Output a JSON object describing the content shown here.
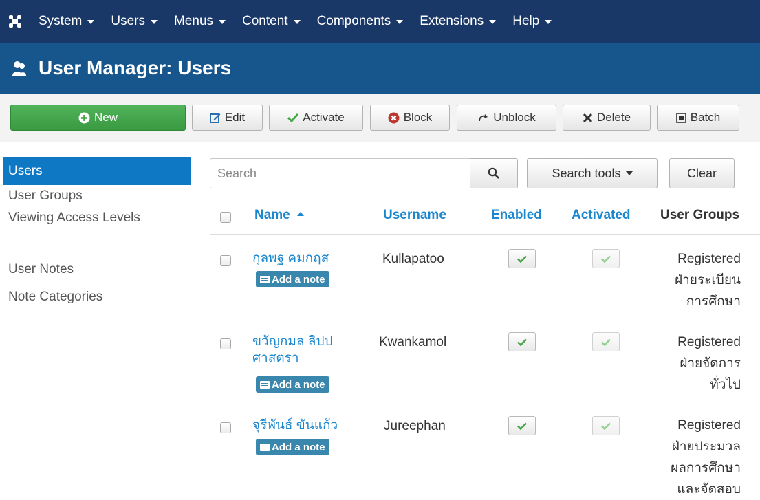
{
  "nav": {
    "menu": [
      {
        "label": "System"
      },
      {
        "label": "Users"
      },
      {
        "label": "Menus"
      },
      {
        "label": "Content"
      },
      {
        "label": "Components"
      },
      {
        "label": "Extensions"
      },
      {
        "label": "Help"
      }
    ]
  },
  "header": {
    "title": "User Manager: Users",
    "icon": "users-icon"
  },
  "toolbar": {
    "new_label": "New",
    "edit_label": "Edit",
    "activate_label": "Activate",
    "block_label": "Block",
    "unblock_label": "Unblock",
    "delete_label": "Delete",
    "batch_label": "Batch"
  },
  "sidebar": {
    "items": [
      {
        "label": "Users"
      },
      {
        "label": "User Groups"
      },
      {
        "label": "Viewing Access Levels"
      },
      {
        "label": "User Notes"
      },
      {
        "label": "Note Categories"
      }
    ]
  },
  "filters": {
    "search_placeholder": "Search",
    "search_tools_label": "Search tools",
    "clear_label": "Clear"
  },
  "table": {
    "columns": {
      "name": "Name",
      "username": "Username",
      "enabled": "Enabled",
      "activated": "Activated",
      "groups": "User Groups"
    },
    "note_label": "Add a note",
    "rows": [
      {
        "name": [
          "กุลพฐ คมกฤส"
        ],
        "username": "Kullapatoo",
        "groups": [
          "Registered",
          "ฝ่ายระเบียน",
          "การศึกษา"
        ]
      },
      {
        "name": [
          "ขวัญกมล ลิปป",
          "ศาสตรา"
        ],
        "username": "Kwankamol",
        "groups": [
          "Registered",
          "ฝ่ายจัดการ",
          "ทั่วไป"
        ]
      },
      {
        "name": [
          "จุรีพันธ์ ขันแก้ว"
        ],
        "username": "Jureephan",
        "groups": [
          "Registered",
          "ฝ่ายประมวล",
          "ผลการศึกษา",
          "และจัดสอบ"
        ]
      }
    ]
  },
  "colors": {
    "nav_bg": "#1a3867",
    "header_bg": "#17568c",
    "accent": "#1b87cf",
    "new_btn": "#46a546",
    "note_badge": "#3a87ad"
  }
}
